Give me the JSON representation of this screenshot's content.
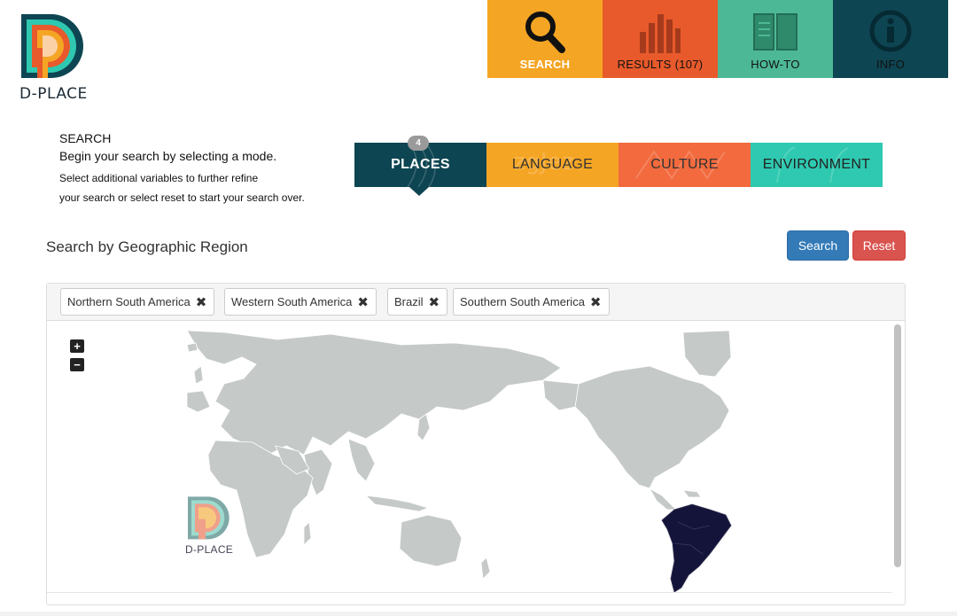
{
  "logo": {
    "text": "D-PLACE"
  },
  "nav": {
    "items": [
      {
        "label": "SEARCH",
        "icon": "search-icon"
      },
      {
        "label": "RESULTS (107)",
        "icon": "bar-chart-icon"
      },
      {
        "label": "HOW-TO",
        "icon": "book-icon"
      },
      {
        "label": "INFO",
        "icon": "info-icon"
      }
    ]
  },
  "intro": {
    "heading": "SEARCH",
    "line1": "Begin your search by selecting a mode.",
    "line2": "Select additional variables to further refine",
    "line3": "your search or select reset to start your search over."
  },
  "modes": {
    "badge": "4",
    "tabs": [
      {
        "label": "PLACES"
      },
      {
        "label": "LANGUAGE"
      },
      {
        "label": "CULTURE"
      },
      {
        "label": "ENVIRONMENT"
      }
    ]
  },
  "section": {
    "title": "Search by Geographic Region",
    "search_label": "Search",
    "reset_label": "Reset"
  },
  "chips": [
    {
      "label": "Northern South America"
    },
    {
      "label": "Western South America"
    },
    {
      "label": "Brazil"
    },
    {
      "label": "Southern South America"
    }
  ],
  "map": {
    "zoom_in": "+",
    "zoom_out": "−",
    "watermark": "D-PLACE",
    "land_color": "#c5c9c8",
    "selected_color": "#14143a"
  },
  "colors": {
    "search": "#f5a524",
    "results": "#e85a2b",
    "howto": "#4db896",
    "info": "#0e4552"
  }
}
